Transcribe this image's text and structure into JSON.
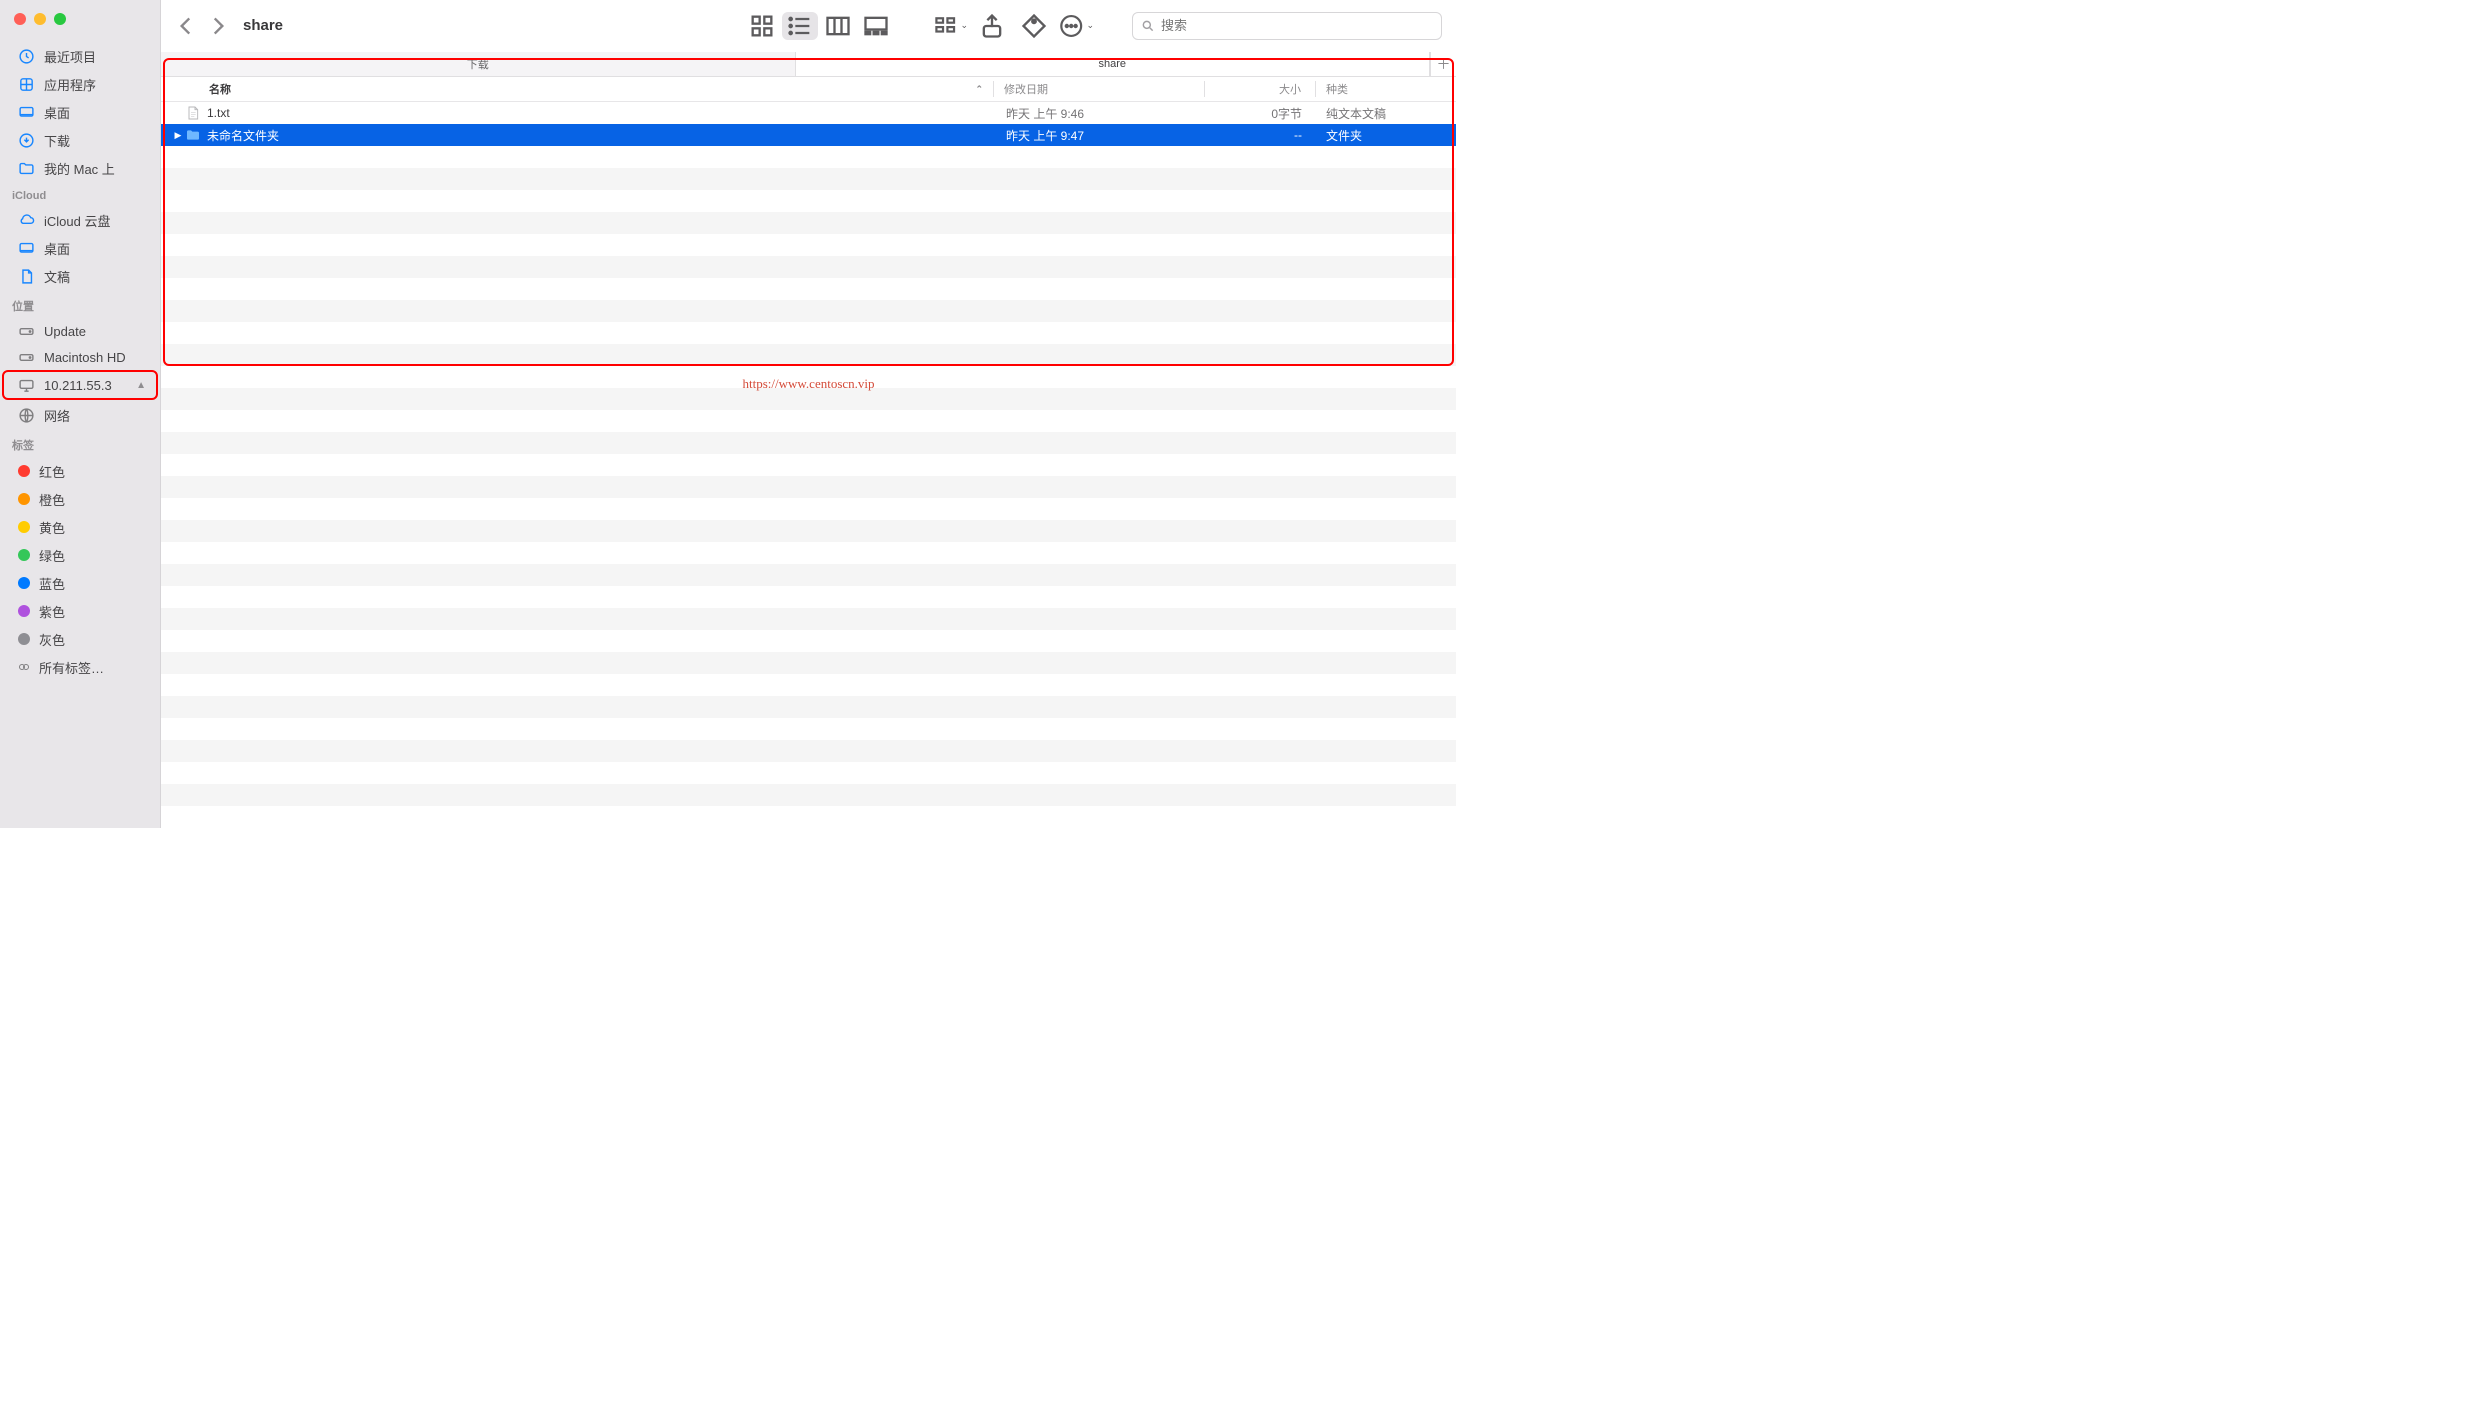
{
  "window": {
    "title": "share"
  },
  "toolbar": {
    "search_placeholder": "搜索"
  },
  "sidebar": {
    "favorites": [
      {
        "id": "recents",
        "label": "最近项目",
        "icon": "clock"
      },
      {
        "id": "applications",
        "label": "应用程序",
        "icon": "apps"
      },
      {
        "id": "desktop",
        "label": "桌面",
        "icon": "desktop"
      },
      {
        "id": "downloads",
        "label": "下载",
        "icon": "download"
      },
      {
        "id": "on-my-mac",
        "label": "我的 Mac 上",
        "icon": "folder"
      }
    ],
    "icloud_header": "iCloud",
    "icloud": [
      {
        "id": "icloud-drive",
        "label": "iCloud 云盘",
        "icon": "cloud"
      },
      {
        "id": "desktop-icloud",
        "label": "桌面",
        "icon": "desktop"
      },
      {
        "id": "documents",
        "label": "文稿",
        "icon": "doc"
      }
    ],
    "locations_header": "位置",
    "locations": [
      {
        "id": "update",
        "label": "Update",
        "icon": "disk"
      },
      {
        "id": "macintosh-hd",
        "label": "Macintosh HD",
        "icon": "disk"
      },
      {
        "id": "network-host",
        "label": "10.211.55.3",
        "icon": "display",
        "ejectable": true,
        "highlighted": true
      },
      {
        "id": "network",
        "label": "网络",
        "icon": "globe"
      }
    ],
    "tags_header": "标签",
    "tags": [
      {
        "id": "red",
        "label": "红色",
        "color": "#ff3b30"
      },
      {
        "id": "orange",
        "label": "橙色",
        "color": "#ff9500"
      },
      {
        "id": "yellow",
        "label": "黄色",
        "color": "#ffcc00"
      },
      {
        "id": "green",
        "label": "绿色",
        "color": "#34c759"
      },
      {
        "id": "blue",
        "label": "蓝色",
        "color": "#007aff"
      },
      {
        "id": "purple",
        "label": "紫色",
        "color": "#af52de"
      },
      {
        "id": "gray",
        "label": "灰色",
        "color": "#8e8e93"
      },
      {
        "id": "all-tags",
        "label": "所有标签…",
        "color": null
      }
    ]
  },
  "tabs": [
    {
      "id": "downloads",
      "label": "下载",
      "active": false
    },
    {
      "id": "share",
      "label": "share",
      "active": true
    }
  ],
  "columns": {
    "name": "名称",
    "date": "修改日期",
    "size": "大小",
    "kind": "种类"
  },
  "files": [
    {
      "name": "1.txt",
      "date": "昨天 上午 9:46",
      "size": "0字节",
      "kind": "纯文本文稿",
      "type": "file",
      "selected": false
    },
    {
      "name": "未命名文件夹",
      "date": "昨天 上午 9:47",
      "size": "--",
      "kind": "文件夹",
      "type": "folder",
      "selected": true
    }
  ],
  "watermark": "https://www.centoscn.vip"
}
